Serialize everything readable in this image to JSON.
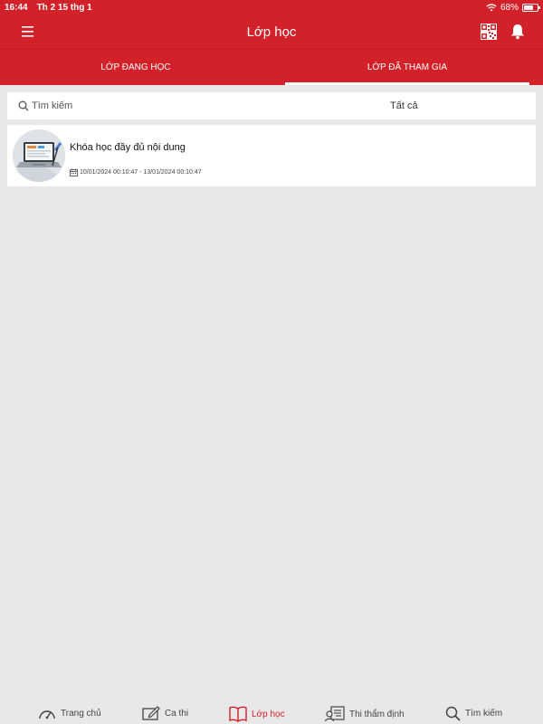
{
  "status_bar": {
    "time": "16:44",
    "date": "Th 2 15 thg 1",
    "battery": "68%",
    "battery_level": 0.68
  },
  "app_bar": {
    "title": "Lớp học",
    "menu_icon": "menu-icon",
    "qr_icon": "qr-code-icon",
    "bell_icon": "bell-icon"
  },
  "tabs": [
    {
      "label": "LỚP ĐANG HỌC",
      "active": false
    },
    {
      "label": "LỚP ĐÃ THAM GIA",
      "active": true
    }
  ],
  "search": {
    "placeholder": "Tìm kiếm",
    "filter_label": "Tất cả"
  },
  "courses": [
    {
      "title": "Khóa học đầy đủ nội dung",
      "date_range": "10/01/2024 00:10:47 - 13/01/2024 00:10:47"
    }
  ],
  "bottom_nav": [
    {
      "label": "Trang chủ",
      "icon": "speedometer-icon",
      "active": false
    },
    {
      "label": "Ca thi",
      "icon": "edit-icon",
      "active": false
    },
    {
      "label": "Lớp học",
      "icon": "book-icon",
      "active": true
    },
    {
      "label": "Thi thẩm định",
      "icon": "certificate-icon",
      "active": false
    },
    {
      "label": "Tìm kiếm",
      "icon": "search-icon",
      "active": false
    }
  ],
  "colors": {
    "primary": "#d32129",
    "background": "#e8e8e8"
  }
}
